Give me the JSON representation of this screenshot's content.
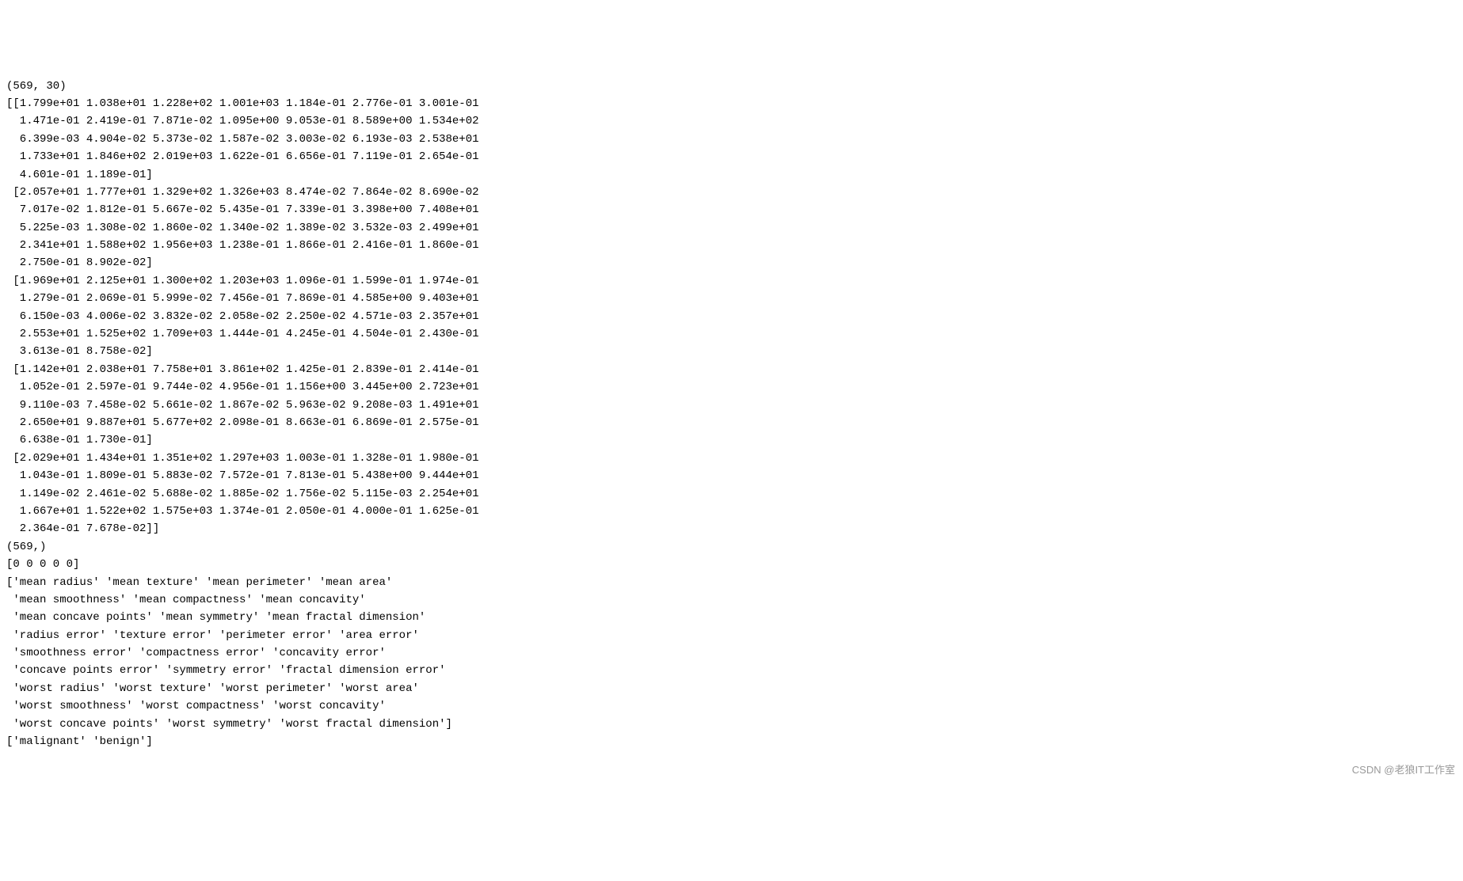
{
  "chart_data": {
    "type": "table",
    "shape_x": [
      569,
      30
    ],
    "x_sample": [
      [
        "1.799e+01",
        "1.038e+01",
        "1.228e+02",
        "1.001e+03",
        "1.184e-01",
        "2.776e-01",
        "3.001e-01",
        "1.471e-01",
        "2.419e-01",
        "7.871e-02",
        "1.095e+00",
        "9.053e-01",
        "8.589e+00",
        "1.534e+02",
        "6.399e-03",
        "4.904e-02",
        "5.373e-02",
        "1.587e-02",
        "3.003e-02",
        "6.193e-03",
        "2.538e+01",
        "1.733e+01",
        "1.846e+02",
        "2.019e+03",
        "1.622e-01",
        "6.656e-01",
        "7.119e-01",
        "2.654e-01",
        "4.601e-01",
        "1.189e-01"
      ],
      [
        "2.057e+01",
        "1.777e+01",
        "1.329e+02",
        "1.326e+03",
        "8.474e-02",
        "7.864e-02",
        "8.690e-02",
        "7.017e-02",
        "1.812e-01",
        "5.667e-02",
        "5.435e-01",
        "7.339e-01",
        "3.398e+00",
        "7.408e+01",
        "5.225e-03",
        "1.308e-02",
        "1.860e-02",
        "1.340e-02",
        "1.389e-02",
        "3.532e-03",
        "2.499e+01",
        "2.341e+01",
        "1.588e+02",
        "1.956e+03",
        "1.238e-01",
        "1.866e-01",
        "2.416e-01",
        "1.860e-01",
        "2.750e-01",
        "8.902e-02"
      ],
      [
        "1.969e+01",
        "2.125e+01",
        "1.300e+02",
        "1.203e+03",
        "1.096e-01",
        "1.599e-01",
        "1.974e-01",
        "1.279e-01",
        "2.069e-01",
        "5.999e-02",
        "7.456e-01",
        "7.869e-01",
        "4.585e+00",
        "9.403e+01",
        "6.150e-03",
        "4.006e-02",
        "3.832e-02",
        "2.058e-02",
        "2.250e-02",
        "4.571e-03",
        "2.357e+01",
        "1.525e+02",
        "1.709e+03",
        "1.444e-01",
        "4.245e-01",
        "4.504e-01",
        "2.430e-01",
        "3.613e-01",
        "8.758e-02"
      ],
      [
        "1.142e+01",
        "2.038e+01",
        "7.758e+01",
        "3.861e+02",
        "1.425e-01",
        "2.839e-01",
        "2.414e-01",
        "1.052e-01",
        "2.597e-01",
        "9.744e-02",
        "4.956e-01",
        "1.156e+00",
        "3.445e+00",
        "2.723e+01",
        "9.110e-03",
        "7.458e-02",
        "5.661e-02",
        "1.867e-02",
        "5.963e-02",
        "9.208e-03",
        "1.491e+01",
        "2.650e+01",
        "9.887e+01",
        "5.677e+02",
        "2.098e-01",
        "8.663e-01",
        "6.869e-01",
        "2.575e-01",
        "6.638e-01",
        "1.730e-01"
      ],
      [
        "2.029e+01",
        "1.434e+01",
        "1.351e+02",
        "1.297e+03",
        "1.003e-01",
        "1.328e-01",
        "1.980e-01",
        "1.043e-01",
        "1.809e-01",
        "5.883e-02",
        "7.572e-01",
        "7.813e-01",
        "5.438e+00",
        "9.444e+01",
        "1.149e-02",
        "2.461e-02",
        "5.688e-02",
        "1.885e-02",
        "1.756e-02",
        "5.115e-03",
        "2.254e+01",
        "1.667e+01",
        "1.522e+02",
        "1.575e+03",
        "1.374e-01",
        "2.050e-01",
        "4.000e-01",
        "1.625e-01",
        "2.364e-01",
        "7.678e-02"
      ]
    ],
    "shape_y": [
      569
    ],
    "y_sample": [
      0,
      0,
      0,
      0,
      0
    ],
    "feature_names": [
      "mean radius",
      "mean texture",
      "mean perimeter",
      "mean area",
      "mean smoothness",
      "mean compactness",
      "mean concavity",
      "mean concave points",
      "mean symmetry",
      "mean fractal dimension",
      "radius error",
      "texture error",
      "perimeter error",
      "area error",
      "smoothness error",
      "compactness error",
      "concavity error",
      "concave points error",
      "symmetry error",
      "fractal dimension error",
      "worst radius",
      "worst texture",
      "worst perimeter",
      "worst area",
      "worst smoothness",
      "worst compactness",
      "worst concavity",
      "worst concave points",
      "worst symmetry",
      "worst fractal dimension"
    ],
    "target_names": [
      "malignant",
      "benign"
    ]
  },
  "lines": [
    "(569, 30)",
    "[[1.799e+01 1.038e+01 1.228e+02 1.001e+03 1.184e-01 2.776e-01 3.001e-01",
    "  1.471e-01 2.419e-01 7.871e-02 1.095e+00 9.053e-01 8.589e+00 1.534e+02",
    "  6.399e-03 4.904e-02 5.373e-02 1.587e-02 3.003e-02 6.193e-03 2.538e+01",
    "  1.733e+01 1.846e+02 2.019e+03 1.622e-01 6.656e-01 7.119e-01 2.654e-01",
    "  4.601e-01 1.189e-01]",
    " [2.057e+01 1.777e+01 1.329e+02 1.326e+03 8.474e-02 7.864e-02 8.690e-02",
    "  7.017e-02 1.812e-01 5.667e-02 5.435e-01 7.339e-01 3.398e+00 7.408e+01",
    "  5.225e-03 1.308e-02 1.860e-02 1.340e-02 1.389e-02 3.532e-03 2.499e+01",
    "  2.341e+01 1.588e+02 1.956e+03 1.238e-01 1.866e-01 2.416e-01 1.860e-01",
    "  2.750e-01 8.902e-02]",
    " [1.969e+01 2.125e+01 1.300e+02 1.203e+03 1.096e-01 1.599e-01 1.974e-01",
    "  1.279e-01 2.069e-01 5.999e-02 7.456e-01 7.869e-01 4.585e+00 9.403e+01",
    "  6.150e-03 4.006e-02 3.832e-02 2.058e-02 2.250e-02 4.571e-03 2.357e+01",
    "  2.553e+01 1.525e+02 1.709e+03 1.444e-01 4.245e-01 4.504e-01 2.430e-01",
    "  3.613e-01 8.758e-02]",
    " [1.142e+01 2.038e+01 7.758e+01 3.861e+02 1.425e-01 2.839e-01 2.414e-01",
    "  1.052e-01 2.597e-01 9.744e-02 4.956e-01 1.156e+00 3.445e+00 2.723e+01",
    "  9.110e-03 7.458e-02 5.661e-02 1.867e-02 5.963e-02 9.208e-03 1.491e+01",
    "  2.650e+01 9.887e+01 5.677e+02 2.098e-01 8.663e-01 6.869e-01 2.575e-01",
    "  6.638e-01 1.730e-01]",
    " [2.029e+01 1.434e+01 1.351e+02 1.297e+03 1.003e-01 1.328e-01 1.980e-01",
    "  1.043e-01 1.809e-01 5.883e-02 7.572e-01 7.813e-01 5.438e+00 9.444e+01",
    "  1.149e-02 2.461e-02 5.688e-02 1.885e-02 1.756e-02 5.115e-03 2.254e+01",
    "  1.667e+01 1.522e+02 1.575e+03 1.374e-01 2.050e-01 4.000e-01 1.625e-01",
    "  2.364e-01 7.678e-02]]",
    "(569,)",
    "[0 0 0 0 0]",
    "['mean radius' 'mean texture' 'mean perimeter' 'mean area'",
    " 'mean smoothness' 'mean compactness' 'mean concavity'",
    " 'mean concave points' 'mean symmetry' 'mean fractal dimension'",
    " 'radius error' 'texture error' 'perimeter error' 'area error'",
    " 'smoothness error' 'compactness error' 'concavity error'",
    " 'concave points error' 'symmetry error' 'fractal dimension error'",
    " 'worst radius' 'worst texture' 'worst perimeter' 'worst area'",
    " 'worst smoothness' 'worst compactness' 'worst concavity'",
    " 'worst concave points' 'worst symmetry' 'worst fractal dimension']",
    "['malignant' 'benign']"
  ],
  "watermark": "CSDN @老狼IT工作室"
}
